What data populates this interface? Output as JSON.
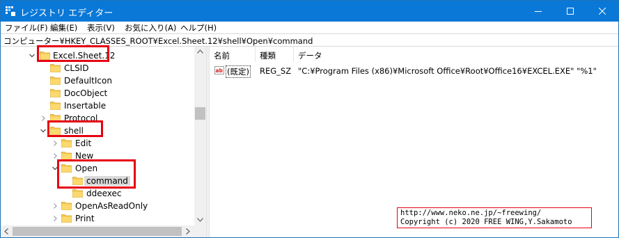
{
  "window": {
    "title": "レジストリ エディター",
    "minimize_icon": "minimize-icon",
    "maximize_icon": "maximize-icon",
    "close_icon": "close-icon"
  },
  "menu": [
    "ファイル(F)",
    "編集(E)",
    "表示(V)",
    "お気に入り(A)",
    "ヘルプ(H)"
  ],
  "address": "コンピューター¥HKEY_CLASSES_ROOT¥Excel.Sheet.12¥shell¥Open¥command",
  "tree": [
    {
      "label": "Excel.Sheet.12",
      "chevron": "expanded"
    },
    {
      "label": "CLSID",
      "chevron": "none"
    },
    {
      "label": "DefaultIcon",
      "chevron": "none"
    },
    {
      "label": "DocObject",
      "chevron": "none"
    },
    {
      "label": "Insertable",
      "chevron": "none"
    },
    {
      "label": "Protocol",
      "chevron": "collapsed"
    },
    {
      "label": "shell",
      "chevron": "expanded"
    },
    {
      "label": "Edit",
      "chevron": "collapsed"
    },
    {
      "label": "New",
      "chevron": "collapsed"
    },
    {
      "label": "Open",
      "chevron": "expanded"
    },
    {
      "label": "command",
      "chevron": "none",
      "selected": true
    },
    {
      "label": "ddeexec",
      "chevron": "none"
    },
    {
      "label": "OpenAsReadOnly",
      "chevron": "collapsed"
    },
    {
      "label": "Print",
      "chevron": "collapsed"
    }
  ],
  "columns": {
    "name": "名前",
    "type": "種類",
    "data": "データ"
  },
  "values": [
    {
      "icon": "string-value-icon",
      "name": "(既定)",
      "type": "REG_SZ",
      "data": "\"C:¥Program Files (x86)¥Microsoft Office¥Root¥Office16¥EXCEL.EXE\" \"%1\""
    }
  ],
  "watermark": {
    "line1": "http://www.neko.ne.jp/~freewing/",
    "line2": "Copyright (c) 2020 FREE WING,Y.Sakamoto"
  },
  "colors": {
    "titlebar": "#0a78d7",
    "highlight": "#e60012",
    "selection": "#d9d9d9",
    "folder": "#f5c84c"
  }
}
